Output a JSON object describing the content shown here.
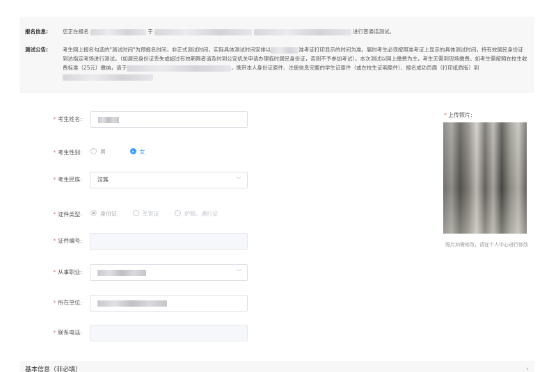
{
  "notice": {
    "reg_info_label": "报名信息:",
    "reg_info_prefix": "您正在报名",
    "reg_info_mid": "于",
    "reg_info_suffix": "进行普通话测试。",
    "announce_label": "测试公告:",
    "announce_p1": "考生网上报名勾选的\"测试时间\"为预报名时间，非正式测试时间，实际具体测试时间安排以",
    "announce_p2": "准考证打印显示的时间为准。届时考生必须按照准考证上显示的具体测试时间，持有效居民身份证到达指定考场进行测试。（如居民身份证丢失或超过有效期限者请及时到公安机关申请办理临时居民身份证，否则不予参加考试）。本次测试以网上缴费为主，考生无需到现场缴费。如考生需按照在校生收费标准（25元）缴纳，请于",
    "announce_p3": "，携带本人身份证原件、注册信息完整的学生证原件（或在校生证明原件）、报名成功页面（打印纸质版）到"
  },
  "form": {
    "name": {
      "label": "考生姓名:"
    },
    "gender": {
      "label": "考生性别:",
      "options": [
        "男",
        "女"
      ],
      "selected": "女"
    },
    "ethnicity": {
      "label": "考生民族:",
      "value": "汉族"
    },
    "id_type": {
      "label": "证件类型:",
      "options": [
        "身份证",
        "军官证",
        "护照、通行证"
      ],
      "selected": "身份证"
    },
    "id_number": {
      "label": "证件编号:"
    },
    "occupation": {
      "label": "从事职业:"
    },
    "employer": {
      "label": "所在单位:"
    },
    "phone": {
      "label": "联系电话:"
    }
  },
  "photo": {
    "label": "上传照片:",
    "hint": "照片如需修改，请在个人中心进行修改"
  },
  "basic_info": {
    "title": "基本信息（非必填）"
  },
  "colors": {
    "required_star": "#f56c6c",
    "radio_checked": "#409eff",
    "panel_bg": "#f7f7f8"
  }
}
